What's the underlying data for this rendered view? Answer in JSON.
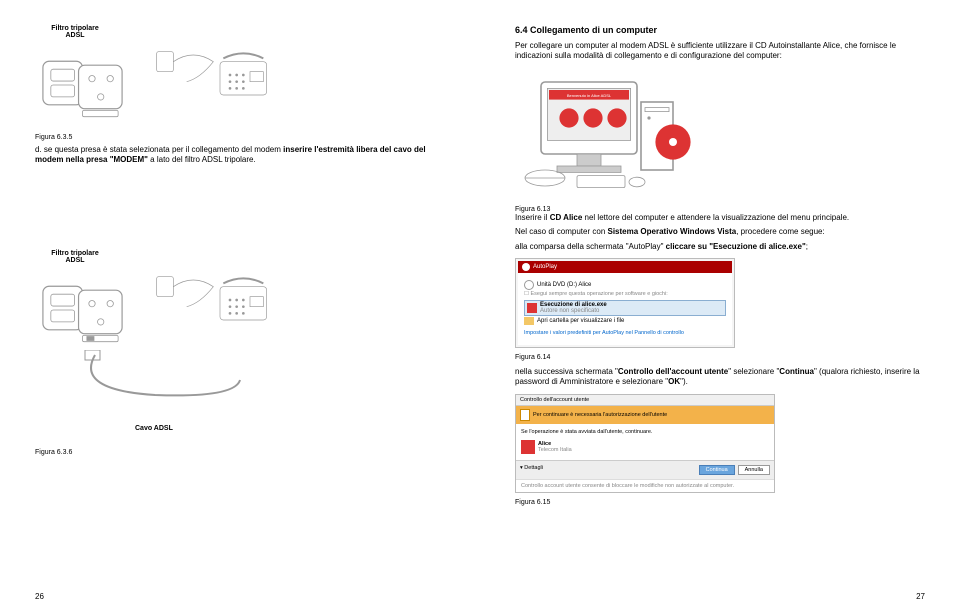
{
  "left": {
    "filtro_label": "Filtro tripolare ADSL",
    "fig635": "Figura 6.3.5",
    "text635d": "d. se questa presa è stata selezionata per il collegamento del modem inserire l'estremità libera del cavo del modem nella presa \"MODEM\" a lato del filtro ADSL tripolare.",
    "cavo_adsl": "Cavo ADSL",
    "fig636": "Figura 6.3.6",
    "page_number": "26"
  },
  "right": {
    "heading": "6.4 Collegamento di un computer",
    "intro": "Per collegare un computer al modem ADSL è sufficiente utilizzare il CD Autoinstallante Alice, che fornisce le indicazioni sulla modalità di collegamento e di configurazione del computer:",
    "fig613": "Figura 6.13",
    "p_inserire_1": "Inserire il ",
    "p_inserire_b1": "CD Alice",
    "p_inserire_2": " nel lettore del computer e attendere la visualizzazione del menu principale.",
    "p_vista_1": "Nel caso di computer con ",
    "p_vista_b1": "Sistema Operativo Windows Vista",
    "p_vista_2": ", procedere come segue:",
    "p_autoplay_1": "alla comparsa della schermata \"AutoPlay\" ",
    "p_autoplay_b1": "cliccare su \"Esecuzione di alice.exe\"",
    "p_autoplay_2": ";",
    "autoplay_title": "AutoPlay",
    "autoplay_device": "Unità DVD (D:) Alice",
    "autoplay_check": "Esegui sempre questa operazione per software e giochi:",
    "autoplay_item1_title": "Esecuzione di alice.exe",
    "autoplay_item1_sub": "Autore non specificato",
    "autoplay_item2": "Apri cartella per visualizzare i file",
    "autoplay_footer": "Impostare i valori predefiniti per AutoPlay nel Pannello di controllo",
    "fig614": "Figura 6.14",
    "p_uac_1": "nella successiva schermata \"",
    "p_uac_b1": "Controllo dell'account utente",
    "p_uac_2": "\" selezionare \"",
    "p_uac_b2": "Continua",
    "p_uac_3": "\" (qualora richiesto, inserire la password di Amministratore e selezionare \"",
    "p_uac_b3": "OK",
    "p_uac_4": "\").",
    "uac_title": "Controllo dell'account utente",
    "uac_header": "Per continuare è necessaria l'autorizzazione dell'utente",
    "uac_body_intro": "Se l'operazione è stata avviata dall'utente, continuare.",
    "uac_app": "Alice",
    "uac_vendor": "Telecom Italia",
    "uac_details": "Dettagli",
    "uac_continue": "Continua",
    "uac_cancel": "Annulla",
    "uac_footer": "Controllo account utente consente di bloccare le modifiche non autorizzate al computer.",
    "fig615": "Figura 6.15",
    "page_number": "27"
  }
}
